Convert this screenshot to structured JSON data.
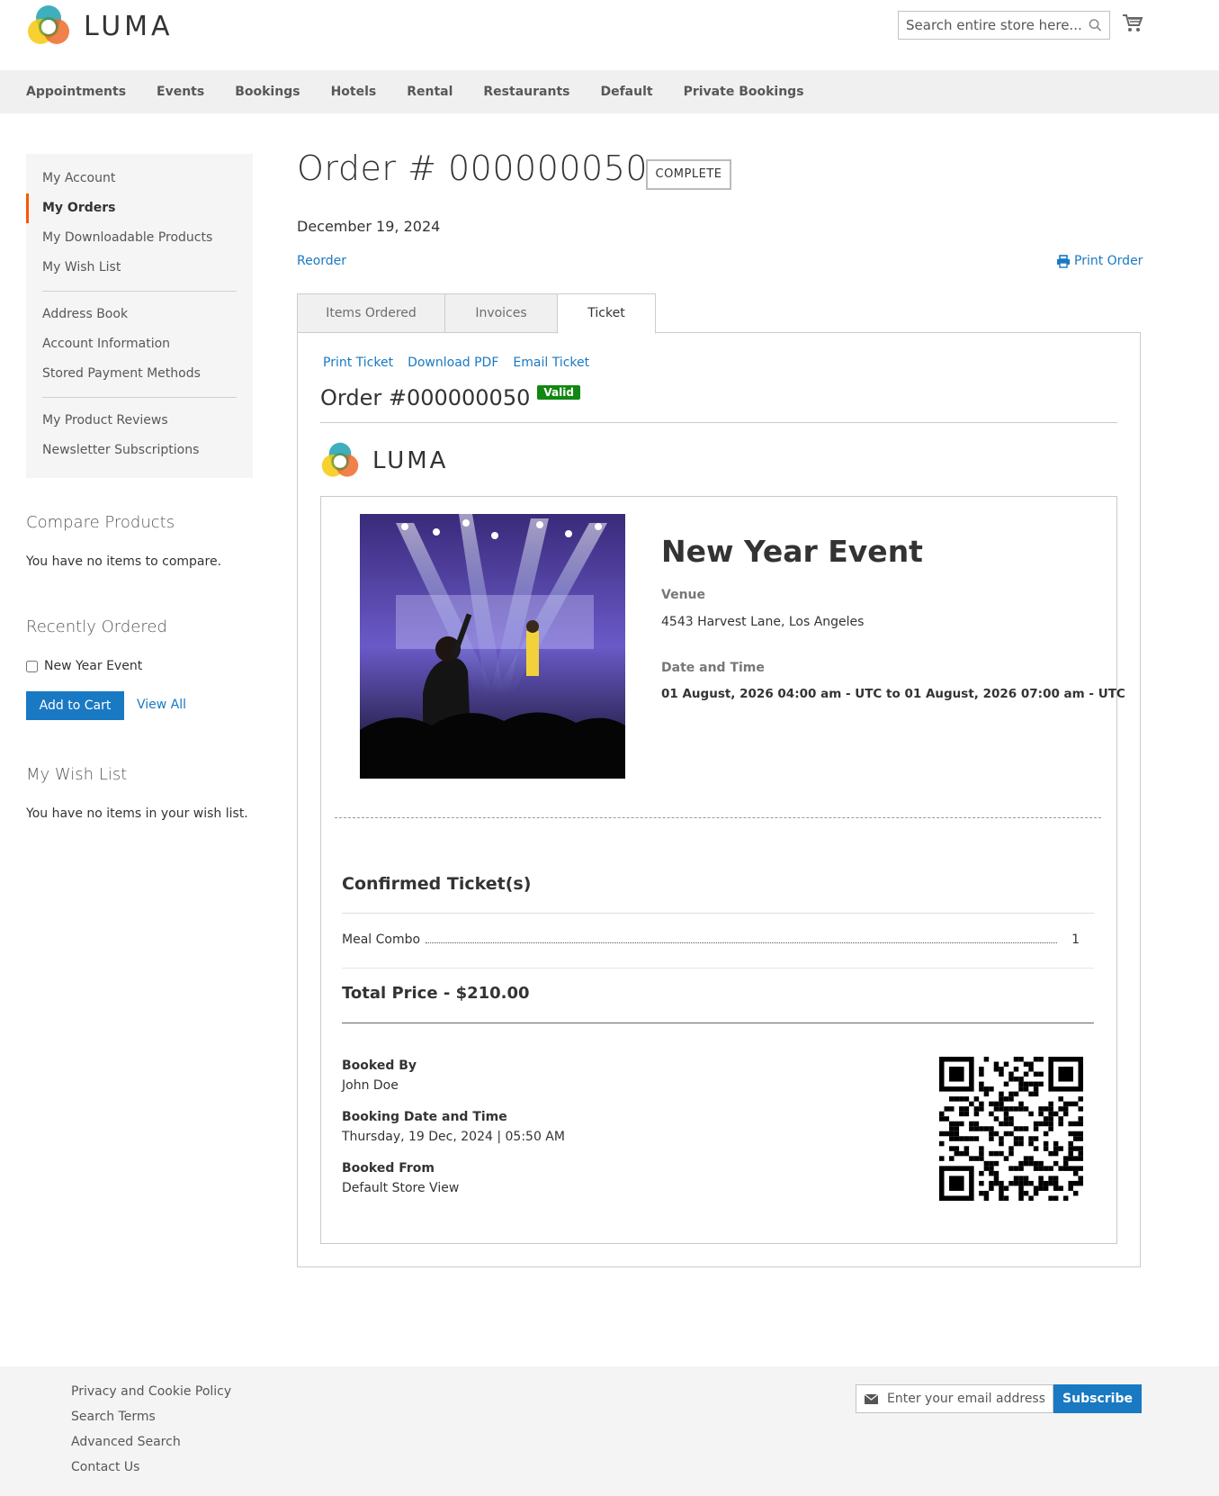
{
  "header": {
    "logo_text": "LUMA",
    "search_placeholder": "Search entire store here...",
    "nav": [
      "Appointments",
      "Events",
      "Bookings",
      "Hotels",
      "Rental",
      "Restaurants",
      "Default",
      "Private Bookings"
    ]
  },
  "sidebar": {
    "items_group1": [
      "My Account",
      "My Orders",
      "My Downloadable Products",
      "My Wish List"
    ],
    "items_group2": [
      "Address Book",
      "Account Information",
      "Stored Payment Methods"
    ],
    "items_group3": [
      "My Product Reviews",
      "Newsletter Subscriptions"
    ],
    "active_item": "My Orders",
    "compare_title": "Compare Products",
    "compare_text": "You have no items to compare.",
    "recent_title": "Recently Ordered",
    "recent_item": "New Year Event",
    "add_to_cart": "Add to Cart",
    "view_all": "View All",
    "wishlist_title": "My Wish List",
    "wishlist_text": "You have no items in your wish list."
  },
  "order": {
    "title": "Order # 000000050",
    "status": "COMPLETE",
    "date": "December 19, 2024",
    "reorder": "Reorder",
    "print_order": "Print Order",
    "tabs": [
      "Items Ordered",
      "Invoices",
      "Ticket"
    ],
    "active_tab": "Ticket"
  },
  "ticket": {
    "actions": [
      "Print Ticket",
      "Download PDF",
      "Email Ticket"
    ],
    "order_label": "Order #000000050",
    "valid": "Valid",
    "logo_text": "LUMA",
    "event_name": "New Year Event",
    "venue_label": "Venue",
    "venue": "4543 Harvest Lane, Los Angeles",
    "datetime_label": "Date and Time",
    "datetime": "01 August, 2026 04:00 am - UTC to 01 August, 2026 07:00 am - UTC",
    "confirmed_title": "Confirmed Ticket(s)",
    "items": [
      {
        "name": "Meal Combo",
        "qty": "1"
      }
    ],
    "total": "Total Price - $210.00",
    "booked_by_label": "Booked By",
    "booked_by": "John Doe",
    "booking_dt_label": "Booking Date and Time",
    "booking_dt": "Thursday, 19 Dec, 2024 | 05:50 AM",
    "booked_from_label": "Booked From",
    "booked_from": "Default Store View"
  },
  "footer": {
    "links": [
      "Privacy and Cookie Policy",
      "Search Terms",
      "Advanced Search",
      "Contact Us"
    ],
    "email_placeholder": "Enter your email address",
    "subscribe": "Subscribe"
  },
  "colors": {
    "accent": "#1979c3",
    "active_marker": "#ff5501",
    "valid": "#118811"
  }
}
